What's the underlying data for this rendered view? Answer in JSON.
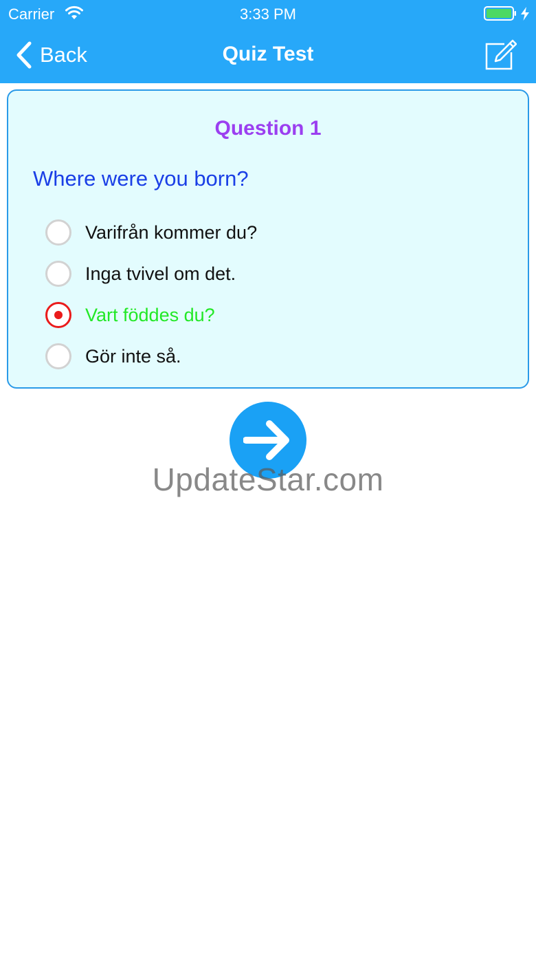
{
  "status_bar": {
    "carrier": "Carrier",
    "time": "3:33 PM",
    "wifi_icon": "wifi-icon",
    "battery_icon": "battery-icon",
    "charging_icon": "bolt-icon"
  },
  "nav": {
    "back_label": "Back",
    "title": "Quiz Test",
    "back_icon": "chevron-left-icon",
    "edit_icon": "edit-icon"
  },
  "quiz": {
    "question_number": "Question 1",
    "question": "Where were you born?",
    "options": [
      {
        "label": "Varifrån kommer du?",
        "selected": false
      },
      {
        "label": "Inga tvivel om det.",
        "selected": false
      },
      {
        "label": "Vart föddes du?",
        "selected": true
      },
      {
        "label": "Gör inte så.",
        "selected": false
      }
    ]
  },
  "next_icon": "arrow-right-icon",
  "watermark": "UpdateStar.com",
  "colors": {
    "nav_bar": "#27a8f9",
    "card_bg": "#e3fcfe",
    "card_border": "#2a9ae8",
    "question_number": "#9b3ff0",
    "question_text": "#1a3fe6",
    "selected_option": "#22e826",
    "selected_radio": "#ea1b1b",
    "next_button": "#1aa1f5"
  }
}
